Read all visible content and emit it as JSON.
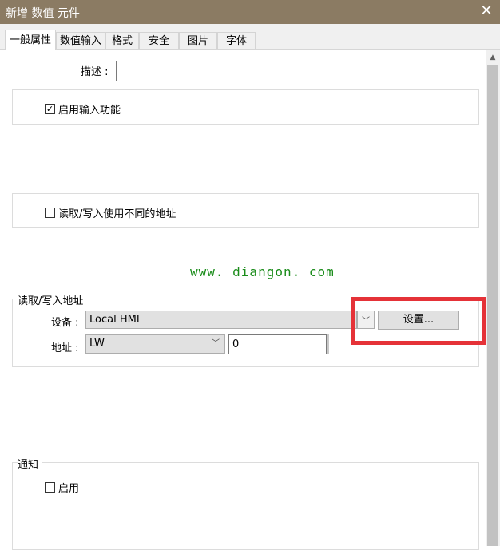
{
  "window": {
    "title": "新增 数值 元件",
    "close_symbol": "✕"
  },
  "tabs": [
    {
      "label": "一般属性",
      "active": true
    },
    {
      "label": "数值输入"
    },
    {
      "label": "格式"
    },
    {
      "label": "安全"
    },
    {
      "label": "图片"
    },
    {
      "label": "字体"
    }
  ],
  "description": {
    "label": "描述 :",
    "value": ""
  },
  "enable_input": {
    "label": "启用输入功能",
    "checked": true
  },
  "rw_diff_address": {
    "label": "读取/写入使用不同的地址",
    "checked": false
  },
  "watermark": "www. diangon. com",
  "rw_address": {
    "group_title": "读取/写入地址",
    "device_label": "设备 :",
    "device_value": "Local HMI",
    "settings_button": "设置...",
    "address_label": "地址 :",
    "address_type": "LW",
    "address_value": "0"
  },
  "notify": {
    "group_title": "通知",
    "enable_label": "启用",
    "checked": false
  },
  "colors": {
    "titlebar": "#8b7b63",
    "highlight": "#e53238",
    "watermark": "#1a8c1a"
  }
}
